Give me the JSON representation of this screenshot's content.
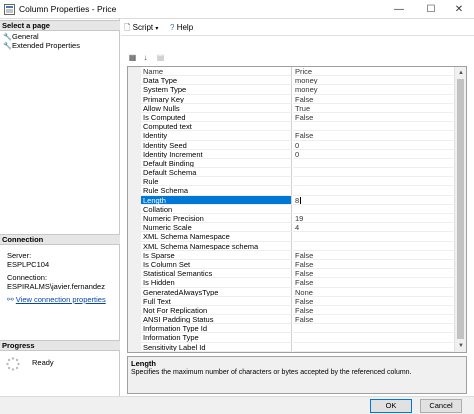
{
  "window": {
    "title": "Column Properties - Price",
    "controls": {
      "minimize": "—",
      "maximize": "☐",
      "close": "✕"
    }
  },
  "left": {
    "select_page_header": "Select a page",
    "pages": [
      "General",
      "Extended Properties"
    ],
    "connection_header": "Connection",
    "server_label": "Server:",
    "server_value": "ESPLPC104",
    "connection_label": "Connection:",
    "connection_value": "ESPIRALMS\\javier.fernandez",
    "view_connection_link": "View connection properties",
    "progress_header": "Progress",
    "progress_status": "Ready"
  },
  "toolbar": {
    "script_label": "Script",
    "help_label": "Help"
  },
  "grid": {
    "header": {
      "name": "Name",
      "value": "Price"
    },
    "rows": [
      {
        "name": "Data Type",
        "value": "money"
      },
      {
        "name": "System Type",
        "value": "money"
      },
      {
        "name": "Primary Key",
        "value": "False"
      },
      {
        "name": "Allow Nulls",
        "value": "True"
      },
      {
        "name": "Is Computed",
        "value": "False"
      },
      {
        "name": "Computed text",
        "value": ""
      },
      {
        "name": "Identity",
        "value": "False"
      },
      {
        "name": "Identity Seed",
        "value": "0"
      },
      {
        "name": "Identity Increment",
        "value": "0"
      },
      {
        "name": "Default Binding",
        "value": ""
      },
      {
        "name": "Default Schema",
        "value": ""
      },
      {
        "name": "Rule",
        "value": ""
      },
      {
        "name": "Rule Schema",
        "value": ""
      },
      {
        "name": "Length",
        "value": "8",
        "selected": true
      },
      {
        "name": "Collation",
        "value": ""
      },
      {
        "name": "Numeric Precision",
        "value": "19"
      },
      {
        "name": "Numeric Scale",
        "value": "4"
      },
      {
        "name": "XML Schema Namespace",
        "value": ""
      },
      {
        "name": "XML Schema Namespace schema",
        "value": ""
      },
      {
        "name": "Is Sparse",
        "value": "False"
      },
      {
        "name": "Is Column Set",
        "value": "False"
      },
      {
        "name": "Statistical Semantics",
        "value": "False"
      },
      {
        "name": "Is Hidden",
        "value": "False"
      },
      {
        "name": "GeneratedAlwaysType",
        "value": "None"
      },
      {
        "name": "Full Text",
        "value": "False"
      },
      {
        "name": "Not For Replication",
        "value": "False"
      },
      {
        "name": "ANSI Padding Status",
        "value": "False"
      },
      {
        "name": "Information Type Id",
        "value": ""
      },
      {
        "name": "Information Type",
        "value": ""
      },
      {
        "name": "Sensitivity Label Id",
        "value": ""
      }
    ]
  },
  "description": {
    "title": "Length",
    "text": "Specifies the maximum number of characters or bytes accepted by the referenced column."
  },
  "buttons": {
    "ok": "OK",
    "cancel": "Cancel"
  }
}
